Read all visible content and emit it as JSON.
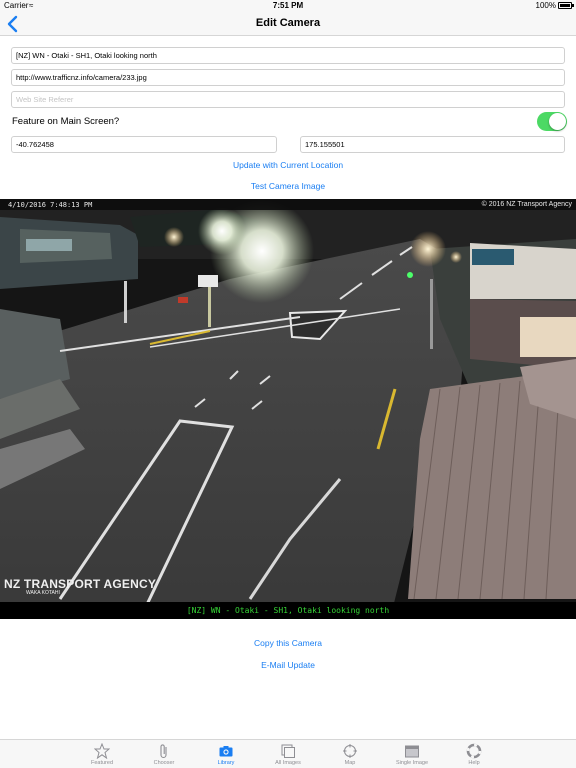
{
  "status_bar": {
    "carrier": "Carrier",
    "time": "7:51 PM",
    "battery": "100%"
  },
  "nav": {
    "title": "Edit Camera",
    "back_icon": "chevron-left-icon"
  },
  "form": {
    "name_value": "[NZ] WN - Otaki - SH1, Otaki looking north",
    "url_value": "http://www.trafficnz.info/camera/233.jpg",
    "referer_placeholder": "Web Site Referer",
    "feature_label": "Feature on Main Screen?",
    "feature_on": true,
    "latitude": "-40.762458",
    "longitude": "175.155501",
    "update_location_label": "Update with Current Location",
    "test_image_label": "Test Camera Image"
  },
  "camera": {
    "timestamp": "4/10/2016 7:48:13 PM",
    "copyright": "© 2016 NZ Transport Agency",
    "logo_text": "NZ TRANSPORT AGENCY",
    "logo_subtext": "WAKA KOTAHI",
    "caption": "[NZ] WN - Otaki - SH1, Otaki looking north"
  },
  "actions": {
    "copy_label": "Copy this Camera",
    "email_label": "E-Mail Update"
  },
  "tabs": [
    {
      "label": "Featured",
      "icon": "star-icon",
      "active": false
    },
    {
      "label": "Chooser",
      "icon": "paperclip-icon",
      "active": false
    },
    {
      "label": "Library",
      "icon": "camera-icon",
      "active": true
    },
    {
      "label": "All Images",
      "icon": "stacked-images-icon",
      "active": false
    },
    {
      "label": "Map",
      "icon": "crosshair-icon",
      "active": false
    },
    {
      "label": "Single Image",
      "icon": "single-image-icon",
      "active": false
    },
    {
      "label": "Help",
      "icon": "lifebuoy-icon",
      "active": false
    }
  ],
  "colors": {
    "accent": "#1a7ef2",
    "toggle_on": "#4cd964",
    "caption_text": "#36d436"
  }
}
